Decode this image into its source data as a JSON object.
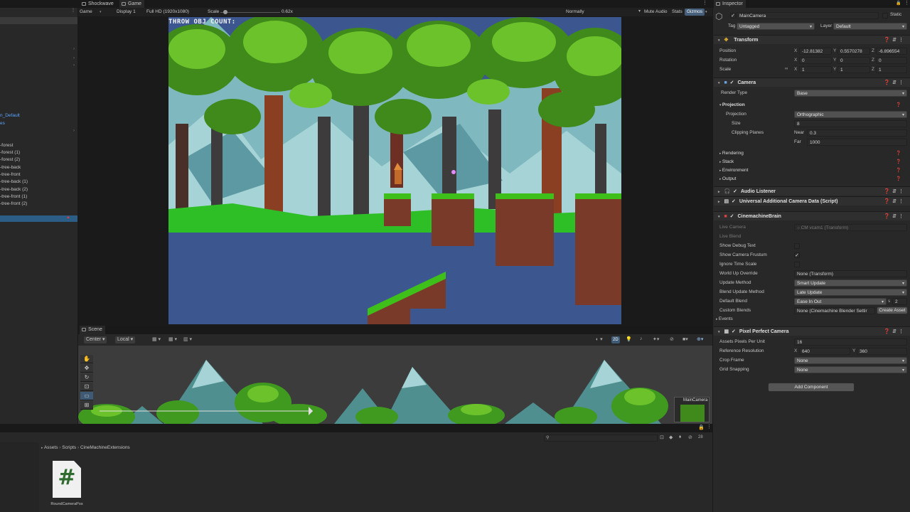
{
  "top_tabs": {
    "shockwave": "Shockwave",
    "game": "Game",
    "inspector": "Inspector"
  },
  "game_toolbar": {
    "mode": "Game",
    "display": "Display 1",
    "resolution": "Full HD (1920x1080)",
    "scale_label": "Scale",
    "scale_value": "0.62x",
    "play_mode": "Normally",
    "mute_audio": "Mute Audio",
    "stats": "Stats",
    "gizmos": "Gizmos",
    "scale_fraction": 0.05
  },
  "hierarchy": {
    "items": [
      {
        "label": "n_Default",
        "blue": true
      },
      {
        "label": "es",
        "blue": true
      },
      {
        "label": "-forest",
        "blue": false
      },
      {
        "label": "-forest (1)",
        "blue": false
      },
      {
        "label": "-forest (2)",
        "blue": false
      },
      {
        "label": "-tree-back",
        "blue": false
      },
      {
        "label": "-tree-front",
        "blue": false
      },
      {
        "label": "-tree-back (1)",
        "blue": false
      },
      {
        "label": "-tree-back (2)",
        "blue": false
      },
      {
        "label": "-tree-front (1)",
        "blue": false
      },
      {
        "label": "-tree-front (2)",
        "blue": false
      }
    ]
  },
  "game_view": {
    "hud": "THROW OBJ COUNT:"
  },
  "scene": {
    "tab": "Scene",
    "pivot": "Center",
    "space": "Local",
    "mode_2d": "2D",
    "camera_label": "MainCamera"
  },
  "project": {
    "breadcrumb": [
      "Assets",
      "Scripts",
      "CineMachineExtensions"
    ],
    "count": "28",
    "asset_name": "RoundCameraPos",
    "asset_symbol": "#"
  },
  "inspector": {
    "object_name": "MainCamera",
    "static_label": "Static",
    "tag_label": "Tag",
    "tag_value": "Untagged",
    "layer_label": "Layer",
    "layer_value": "Default",
    "transform": {
      "title": "Transform",
      "position_label": "Position",
      "px": "-12.81382",
      "py": "0.5570278",
      "pz": "-6.896554",
      "rotation_label": "Rotation",
      "rx": "0",
      "ry": "0",
      "rz": "0",
      "scale_label": "Scale",
      "sx": "1",
      "sy": "1",
      "sz": "1"
    },
    "camera": {
      "title": "Camera",
      "render_type_label": "Render Type",
      "render_type": "Base",
      "projection_section": "Projection",
      "projection_label": "Projection",
      "projection": "Orthographic",
      "size_label": "Size",
      "size": "8",
      "clipping_label": "Clipping Planes",
      "near_label": "Near",
      "near": "0.3",
      "far_label": "Far",
      "far": "1000",
      "rendering": "Rendering",
      "stack": "Stack",
      "environment": "Environment",
      "output": "Output"
    },
    "audio_listener": "Audio Listener",
    "uacd": "Universal Additional Camera Data (Script)",
    "brain": {
      "title": "CinemachineBrain",
      "live_camera_label": "Live Camera",
      "live_camera": "CM vcam1 (Transform)",
      "live_blend_label": "Live Blend",
      "show_debug_label": "Show Debug Text",
      "show_frustum_label": "Show Camera Frustum",
      "ignore_time_label": "Ignore Time Scale",
      "world_up_label": "World Up Override",
      "world_up": "None (Transform)",
      "update_method_label": "Update Method",
      "update_method": "Smart Update",
      "blend_update_label": "Blend Update Method",
      "blend_update": "Late Update",
      "default_blend_label": "Default Blend",
      "default_blend": "Ease In Out",
      "s_label": "s",
      "blend_s": "2",
      "custom_blends_label": "Custom Blends",
      "custom_blends": "None (Cinemachine Blender Settir",
      "create_asset": "Create Asset",
      "events": "Events"
    },
    "ppc": {
      "title": "Pixel Perfect Camera",
      "ppu_label": "Assets Pixels Per Unit",
      "ppu": "16",
      "ref_label": "Reference Resolution",
      "ref_x": "640",
      "ref_y": "360",
      "crop_label": "Crop Frame",
      "crop": "None",
      "grid_label": "Grid Snapping",
      "grid": "None"
    },
    "add_component": "Add Component",
    "axis": {
      "x": "X",
      "y": "Y",
      "z": "Z"
    }
  },
  "colors": {
    "selection": "#2c5d87",
    "accent_blue": "#5aa5ff",
    "panel": "#282828"
  }
}
